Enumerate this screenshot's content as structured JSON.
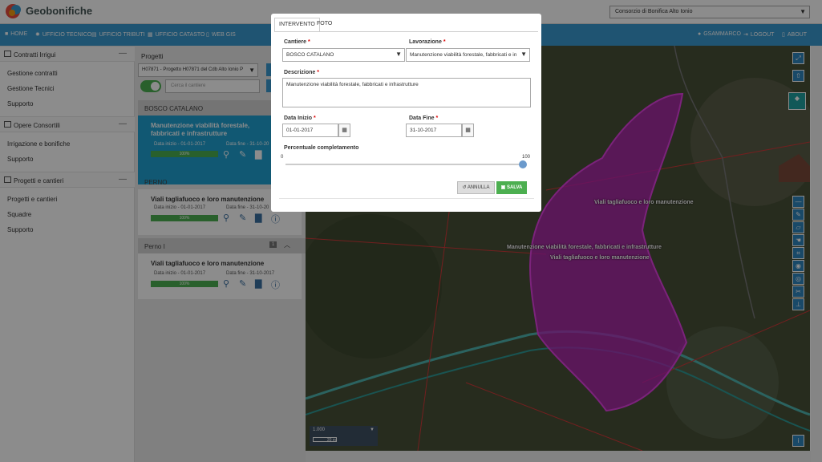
{
  "app": {
    "title": "Geobonifiche",
    "consorzio": "Consorzio di Bonifica Alto Ionio"
  },
  "nav": {
    "home": "HOME",
    "ufficio_tecnico": "UFFICIO TECNICO",
    "ufficio_tributi": "UFFICIO TRIBUTI",
    "ufficio_catasto": "UFFICIO CATASTO",
    "web_gis": "WEB GIS",
    "user": "GSAMMARCO",
    "logout": "LOGOUT",
    "about": "ABOUT"
  },
  "sidebar": {
    "sections": [
      {
        "title": "Contratti Irrigui",
        "items": [
          "Gestione contratti",
          "Gestione Tecnici",
          "Supporto"
        ]
      },
      {
        "title": "Opere Consortili",
        "items": [
          "Irrigazione e bonifiche",
          "Supporto"
        ]
      },
      {
        "title": "Progetti e cantieri",
        "items": [
          "Progetti e cantieri",
          "Squadre",
          "Supporto"
        ]
      }
    ]
  },
  "projects": {
    "title": "Progetti",
    "select_value": "H07871 - Progetto H07871 del Cdb Alto Ionio P",
    "search_placeholder": "Cerca il cantiere",
    "groups": [
      {
        "name": "BOSCO CATALANO",
        "card": {
          "title": "Manutenzione viabilità forestale, fabbricati e infrastrutture",
          "start": "Data inizio - 01-01-2017",
          "end": "Data fine - 31-10-20",
          "progress": "100%"
        }
      },
      {
        "name": "PERNO",
        "card": {
          "title": "Viali tagliafuoco e loro manutenzione",
          "start": "Data inizio - 01-01-2017",
          "end": "Data fine - 31-10-20",
          "progress": "100%"
        }
      },
      {
        "name": "Perno I",
        "badge": "1",
        "card": {
          "title": "Viali tagliafuoco e loro manutenzione",
          "start": "Data inizio - 01-01-2017",
          "end": "Data fine - 31-10-2017",
          "progress": "100%"
        }
      }
    ]
  },
  "map": {
    "labels": [
      "Viali tagliafuoco e loro manutenzione",
      "Manutenzione viabilità forestale, fabbricati e infrastrutture",
      "Viali tagliafuoco e loro manutenzione"
    ],
    "scale_text": "1.000",
    "scale_bar": "20 m",
    "polygon_color": "#c020c0"
  },
  "modal": {
    "tabs": [
      "INTERVENTO",
      "FOTO"
    ],
    "cantiere_label": "Cantiere",
    "cantiere_value": "BOSCO CATALANO",
    "lavorazione_label": "Lavorazione",
    "lavorazione_value": "Manutenzione viabilità forestale, fabbricati e in",
    "descrizione_label": "Descrizione",
    "descrizione_value": "Manutenzione viabilità forestale, fabbricati e infrastrutture",
    "data_inizio_label": "Data Inizio",
    "data_inizio_value": "01-01-2017",
    "data_fine_label": "Data Fine",
    "data_fine_value": "31-10-2017",
    "percentuale_label": "Percentuale completamento",
    "slider_min": "0",
    "slider_max": "100",
    "slider_value": 100,
    "cancel_label": "ANNULLA",
    "save_label": "SALVA",
    "required_mark": "*"
  }
}
